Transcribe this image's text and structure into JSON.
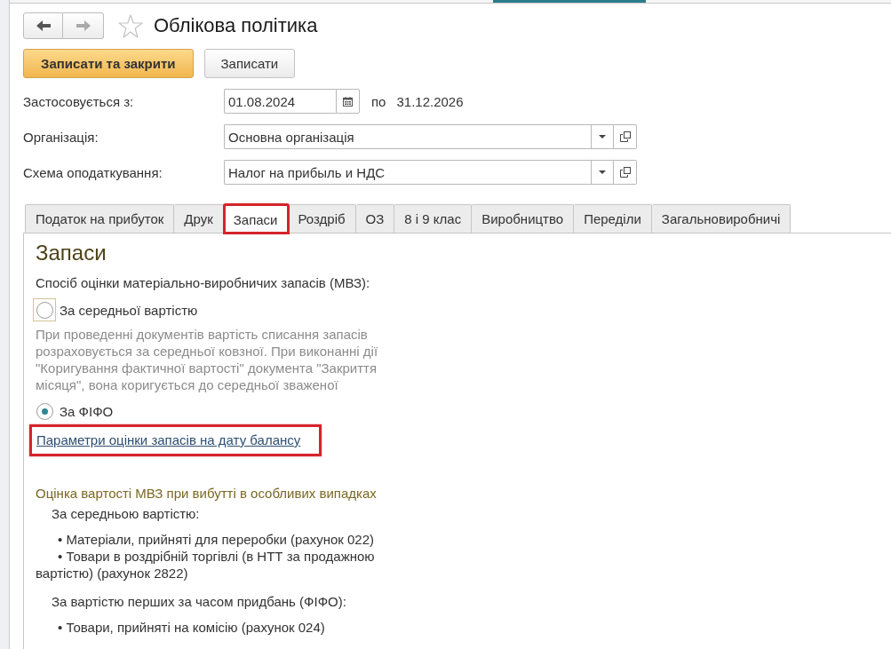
{
  "nav_buttons": [
    {
      "kind": "back",
      "disabled": false
    },
    {
      "kind": "forward",
      "disabled": true
    }
  ],
  "favorite": {
    "starred": false
  },
  "title": "Облікова політика",
  "buttons": [
    {
      "label": "Записати та закрити",
      "default": true
    },
    {
      "label": "Записати",
      "default": false
    }
  ],
  "fields": [
    {
      "kind": "date",
      "label": "Застосовується з:",
      "value": "01.08.2024",
      "to_label": "по",
      "to_value": "31.12.2026"
    },
    {
      "kind": "select",
      "label": "Організація:",
      "value": "Основна організація"
    },
    {
      "kind": "select",
      "label": "Схема оподаткування:",
      "value": "Налог на прибыль и НДС"
    }
  ],
  "tabs": [
    {
      "label": "Податок на прибуток",
      "selected": false,
      "highlighted": false
    },
    {
      "label": "Друк",
      "selected": false,
      "highlighted": false
    },
    {
      "label": "Запаси",
      "selected": true,
      "highlighted": true
    },
    {
      "label": "Роздріб",
      "selected": false,
      "highlighted": false
    },
    {
      "label": "ОЗ",
      "selected": false,
      "highlighted": false
    },
    {
      "label": "8 і 9 клас",
      "selected": false,
      "highlighted": false
    },
    {
      "label": "Виробництво",
      "selected": false,
      "highlighted": false
    },
    {
      "label": "Переділи",
      "selected": false,
      "highlighted": false
    },
    {
      "label": "Загальновиробничі",
      "selected": false,
      "highlighted": false
    }
  ],
  "panel": {
    "heading": "Запаси",
    "prompt": "Спосіб оцінки матеріально-виробничих запасів (МВЗ):",
    "options": [
      {
        "label": "За середньої вартістю",
        "selected": false,
        "focused": true,
        "description": "При проведенні документів вартість списання запасів розраховується за середньої ковзної. При виконанні дії \"Коригування фактичної вартості\" документа \"Закриття місяця\", вона коригується до середньої зваженої"
      },
      {
        "label": "За ФІФО",
        "selected": true,
        "focused": false
      }
    ],
    "link": {
      "text": "Параметри оцінки запасів на дату балансу",
      "highlighted": true
    },
    "notes_heading": "Оцінка вартості МВЗ при вибутті в особливих випадках",
    "notes": [
      {
        "kind": "subheading",
        "text": "За середньою вартістю:"
      },
      {
        "kind": "bullet",
        "text": "• Матеріали, прийняті для переробки (рахунок 022)"
      },
      {
        "kind": "bullet",
        "text": "• Товари в роздрібній торгівлі (в НТТ за продажною вартістю) (рахунок 2822)"
      },
      {
        "kind": "subheading",
        "text": "За вартістю перших за часом придбань (ФІФО):"
      },
      {
        "kind": "bullet",
        "text": "• Товари, прийняті на комісію (рахунок 024)"
      }
    ]
  }
}
